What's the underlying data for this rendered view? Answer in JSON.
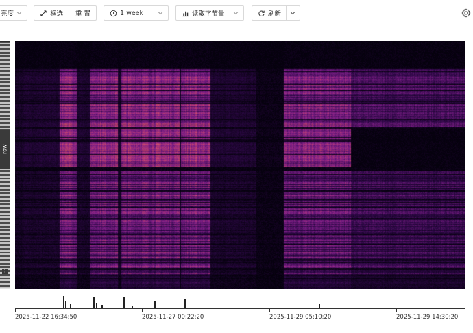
{
  "toolbar": {
    "brightness_label": "亮度",
    "select_label": "框选",
    "reset_label": "重 置",
    "range_value": "1 week",
    "metric_value": "读取字节量",
    "refresh_label": "刷新"
  },
  "row_axis": {
    "label": "row",
    "collapse_marker": "⋮"
  },
  "timeline": {
    "tick_labels": [
      "2025-11-22 16:34:50",
      "2025-11-27 00:22:20",
      "2025-11-29 05:10:20",
      "2025-11-29 14:30:20"
    ]
  },
  "colors": {
    "accent": "#fcd34d",
    "heat_low": "#05010d",
    "heat_mid": "#7a1f8a",
    "heat_high": "#fde68a"
  }
}
